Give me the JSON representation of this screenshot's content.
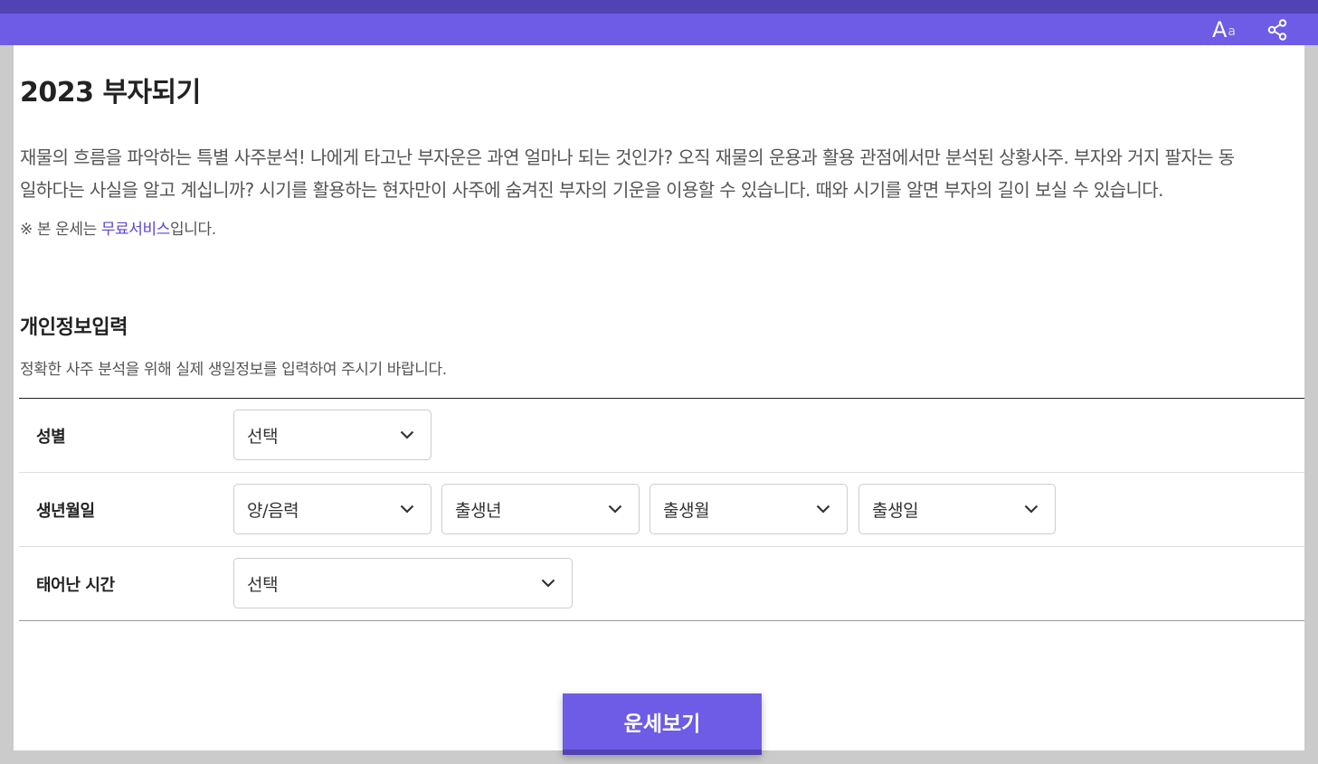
{
  "topbar": {
    "font_icon_main": "A",
    "font_icon_sub": "a",
    "font_icon": "font-size-icon",
    "share_icon": "share-icon"
  },
  "page": {
    "title": "2023 부자되기",
    "description_line1": "재물의 흐름을 파악하는 특별 사주분석! 나에게 타고난 부자운은 과연 얼마나 되는 것인가? 오직 재물의 운용과 활용 관점에서만 분석된 상황사주. 부자와 거지 팔자는 동",
    "description_line2": "일하다는 사실을 알고 계십니까? 시기를 활용하는 현자만이 사주에 숨겨진 부자의 기운을 이용할 수 있습니다. 때와 시기를 알면 부자의 길이 보실 수 있습니다.",
    "note_prefix": "※ 본 운세는 ",
    "note_link": "무료서비스",
    "note_suffix": "입니다."
  },
  "form": {
    "section_title": "개인정보입력",
    "section_sub": "정확한 사주 분석을 위해 실제 생일정보를 입력하여 주시기 바랍니다.",
    "gender": {
      "label": "성별",
      "value": "선택"
    },
    "birth": {
      "label": "생년월일",
      "calendar": "양/음력",
      "year": "출생년",
      "month": "출생월",
      "day": "출생일"
    },
    "time": {
      "label": "태어난 시간",
      "value": "선택"
    }
  },
  "cta": {
    "label": "운세보기"
  },
  "colors": {
    "accent": "#6e5be6",
    "accent_dark": "#5243b3",
    "link": "#5b46d2"
  }
}
